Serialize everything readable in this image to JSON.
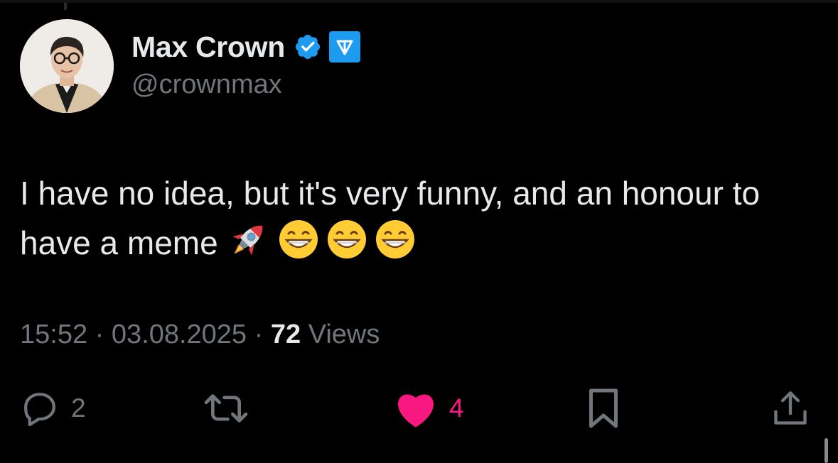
{
  "author": {
    "display_name": "Max Crown",
    "handle": "@crownmax",
    "avatar_icon": "profile-photo",
    "verified_icon": "verified-badge-icon",
    "affiliation_icon": "ton-logo-icon"
  },
  "tweet": {
    "text": "I have no idea, but it's very funny, and an honour to have a meme",
    "emojis": [
      "rocket",
      "grinning-face",
      "grinning-face",
      "grinning-face"
    ]
  },
  "meta": {
    "time": "15:52",
    "separator": "·",
    "date": "03.08.2025",
    "views_count": "72",
    "views_label": "Views"
  },
  "actions": {
    "reply": {
      "icon": "reply-icon",
      "count": "2"
    },
    "retweet": {
      "icon": "retweet-icon",
      "count": ""
    },
    "like": {
      "icon": "heart-icon",
      "count": "4"
    },
    "bookmark": {
      "icon": "bookmark-icon"
    },
    "share": {
      "icon": "share-icon"
    }
  },
  "colors": {
    "background": "#000000",
    "text_primary": "#e7e9ea",
    "text_secondary": "#71767b",
    "verified_blue": "#1d9bf0",
    "like_pink": "#f91880"
  }
}
